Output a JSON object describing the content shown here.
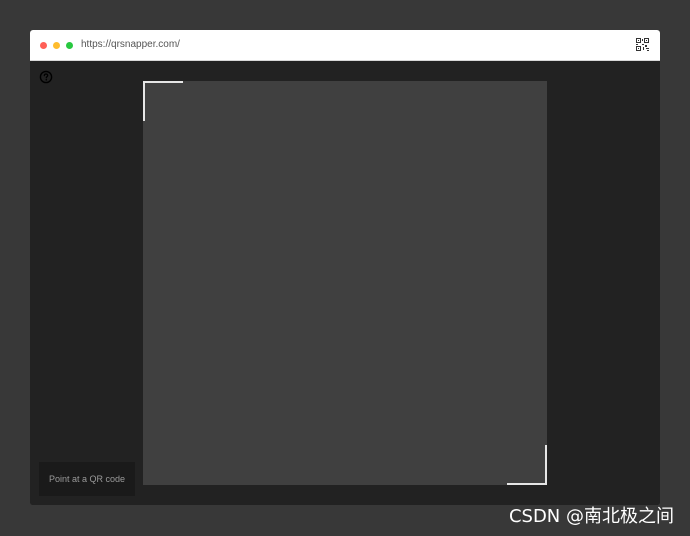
{
  "browser": {
    "url": "https://qrsnapper.com/",
    "icons": {
      "close": "close-dot",
      "minimize": "minimize-dot",
      "maximize": "maximize-dot",
      "qr": "qr-code-icon"
    }
  },
  "scanner": {
    "help_icon": "help-circle-icon",
    "hint": "Point at a QR code"
  },
  "watermark": "CSDN @南北极之间",
  "colors": {
    "page_bg": "#383838",
    "app_bg": "#222222",
    "viewfinder_bg": "#404040",
    "frame_corner": "#e6e6e6"
  }
}
